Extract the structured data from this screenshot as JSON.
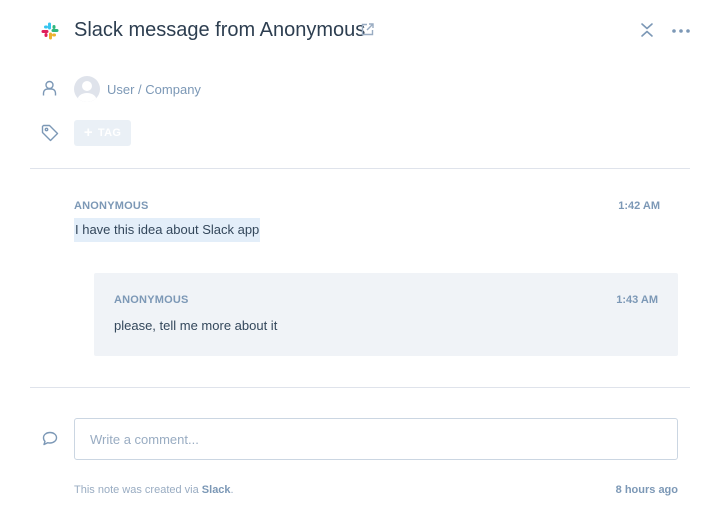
{
  "header": {
    "title": "Slack message from Anonymous",
    "app_icon": "slack-logo-icon",
    "external_link_icon": "external-link-icon",
    "collapse_icon": "collapse-icon",
    "more_icon": "more-options-icon"
  },
  "contact": {
    "icon": "user-icon",
    "label": "User / Company"
  },
  "tags": {
    "icon": "tag-icon",
    "add_label": "TAG",
    "add_symbol": "+"
  },
  "messages": [
    {
      "author": "ANONYMOUS",
      "time": "1:42 AM",
      "text": "I have this idea about Slack app"
    },
    {
      "author": "ANONYMOUS",
      "time": "1:43 AM",
      "text": "please, tell me more about it"
    }
  ],
  "comment": {
    "icon": "comment-icon",
    "placeholder": "Write a comment..."
  },
  "footer": {
    "note_prefix": "This note was created via ",
    "note_source": "Slack",
    "note_suffix": ".",
    "time": "8 hours ago"
  },
  "colors": {
    "text_primary": "#33475b",
    "text_muted": "#7c98b6",
    "divider": "#dfe3eb",
    "reply_background": "#f0f3f7",
    "highlight": "#e3eef9",
    "slack_blue": "#36c5f0",
    "slack_green": "#2eb67d",
    "slack_yellow": "#ecb22e",
    "slack_red": "#e01e5a"
  }
}
